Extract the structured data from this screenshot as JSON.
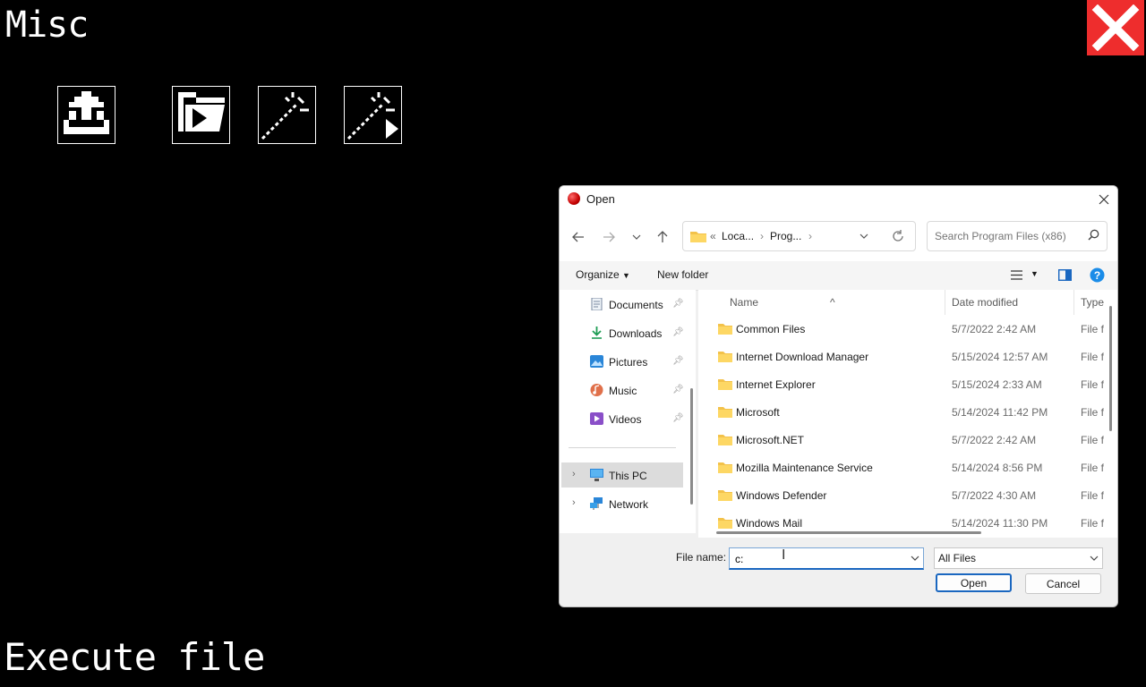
{
  "game": {
    "section_title": "Misc",
    "footer_title": "Execute file",
    "close_color": "#ee2d2d",
    "tools": [
      {
        "icon": "eject-icon"
      },
      {
        "icon": "open-folder-play-icon"
      },
      {
        "icon": "wand-icon"
      },
      {
        "icon": "wand-play-icon"
      }
    ]
  },
  "dialog": {
    "title": "Open",
    "address": {
      "part1": "Loca...",
      "part2": "Prog...",
      "prefix": "«"
    },
    "search_placeholder": "Search Program Files (x86)",
    "toolbar": {
      "organize": "Organize",
      "new_folder": "New folder"
    },
    "nav": {
      "items": [
        {
          "label": "Documents",
          "icon": "documents-icon"
        },
        {
          "label": "Downloads",
          "icon": "downloads-icon"
        },
        {
          "label": "Pictures",
          "icon": "pictures-icon"
        },
        {
          "label": "Music",
          "icon": "music-icon"
        },
        {
          "label": "Videos",
          "icon": "videos-icon"
        }
      ],
      "this_pc": "This PC",
      "network": "Network"
    },
    "columns": {
      "name": "Name",
      "date": "Date modified",
      "type": "Type"
    },
    "files": [
      {
        "name": "Common Files",
        "date": "5/7/2022 2:42 AM",
        "type": "File f"
      },
      {
        "name": "Internet Download Manager",
        "date": "5/15/2024 12:57 AM",
        "type": "File f"
      },
      {
        "name": "Internet Explorer",
        "date": "5/15/2024 2:33 AM",
        "type": "File f"
      },
      {
        "name": "Microsoft",
        "date": "5/14/2024 11:42 PM",
        "type": "File f"
      },
      {
        "name": "Microsoft.NET",
        "date": "5/7/2022 2:42 AM",
        "type": "File f"
      },
      {
        "name": "Mozilla Maintenance Service",
        "date": "5/14/2024 8:56 PM",
        "type": "File f"
      },
      {
        "name": "Windows Defender",
        "date": "5/7/2022 4:30 AM",
        "type": "File f"
      },
      {
        "name": "Windows Mail",
        "date": "5/14/2024 11:30 PM",
        "type": "File f"
      }
    ],
    "file_name_label": "File name:",
    "file_name_value": "c:",
    "file_type": "All Files",
    "open_button": "Open",
    "cancel_button": "Cancel"
  }
}
